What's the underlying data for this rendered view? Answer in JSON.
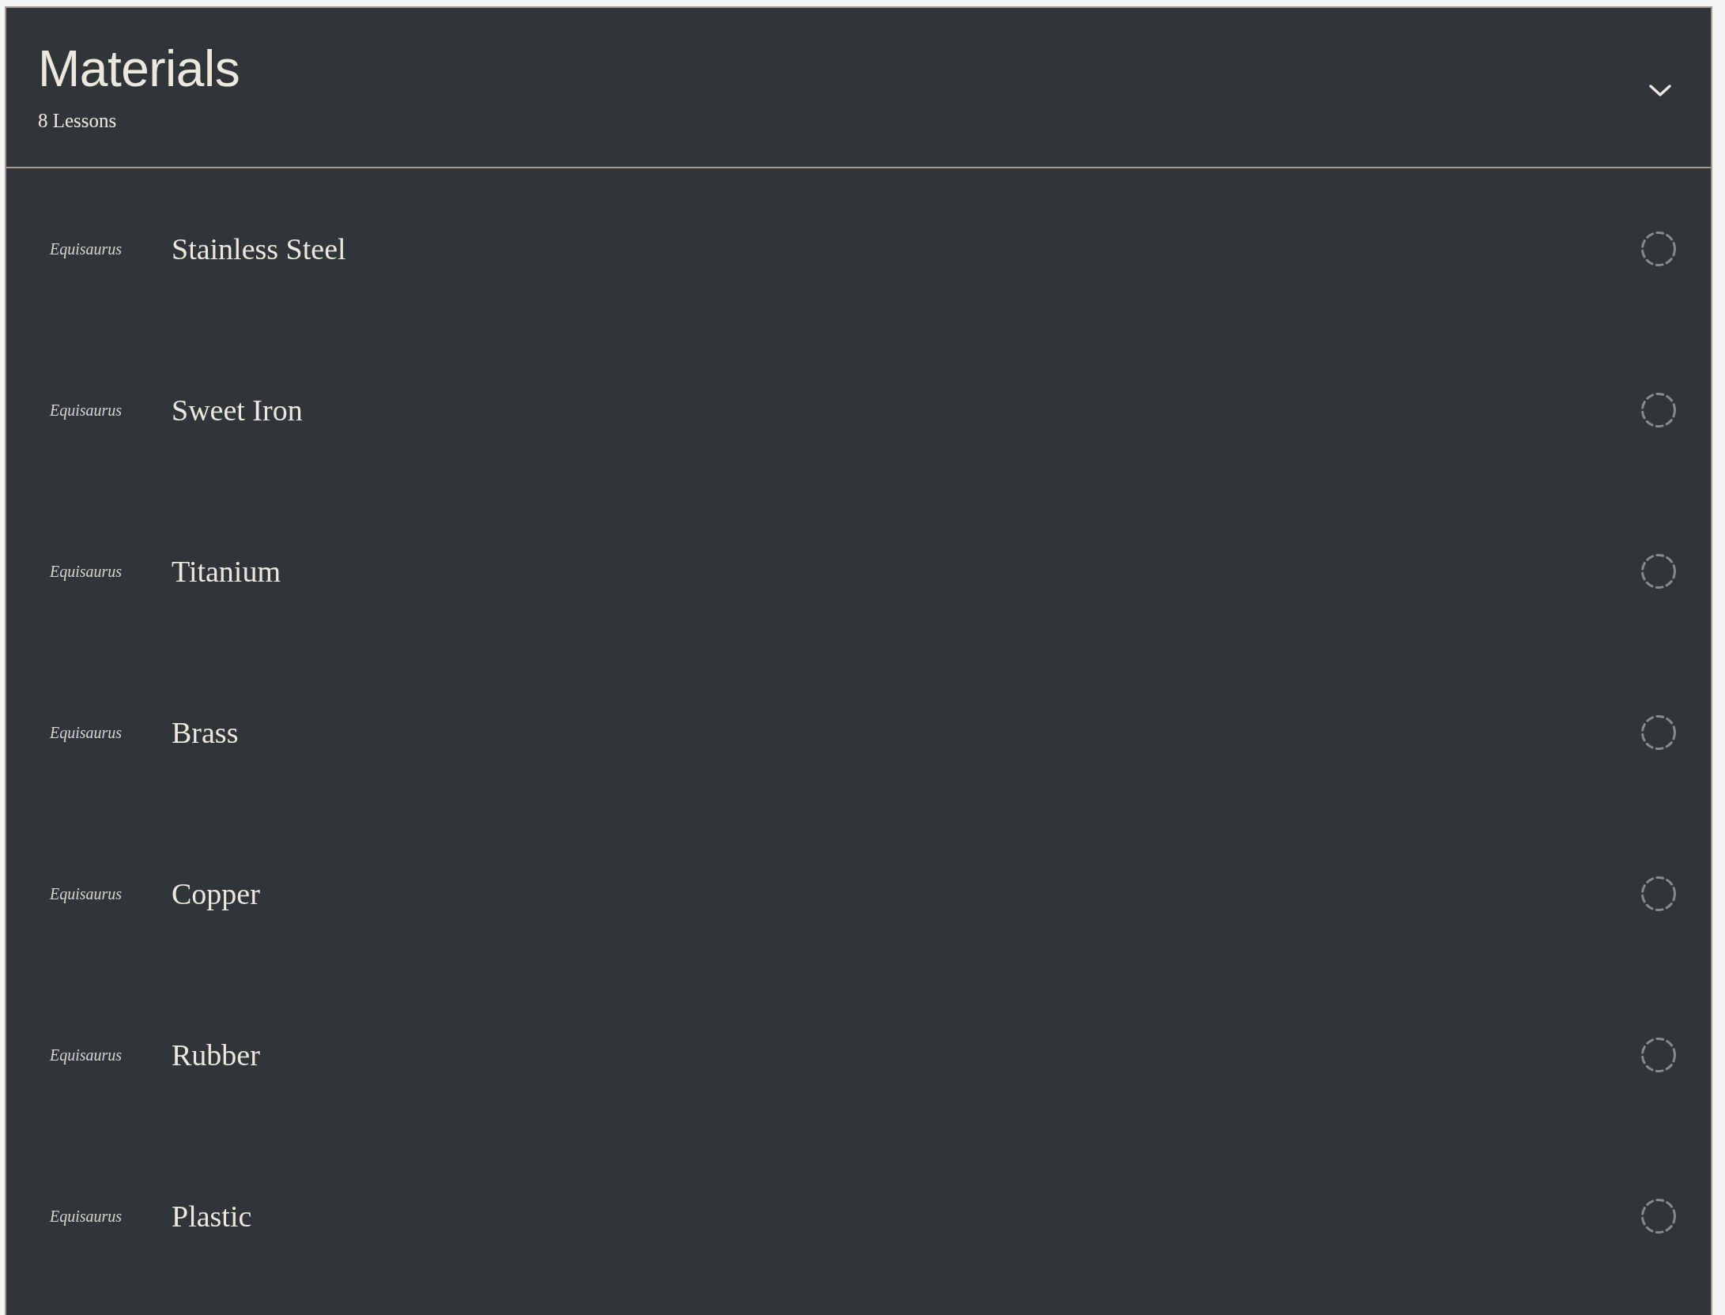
{
  "section": {
    "title": "Materials",
    "subtitle": "8 Lessons",
    "expanded": true
  },
  "lessons": [
    {
      "thumbnail_logo": "Equisaurus",
      "title": "Stainless Steel",
      "completed": false
    },
    {
      "thumbnail_logo": "Equisaurus",
      "title": "Sweet Iron",
      "completed": false
    },
    {
      "thumbnail_logo": "Equisaurus",
      "title": "Titanium",
      "completed": false
    },
    {
      "thumbnail_logo": "Equisaurus",
      "title": "Brass",
      "completed": false
    },
    {
      "thumbnail_logo": "Equisaurus",
      "title": "Copper",
      "completed": false
    },
    {
      "thumbnail_logo": "Equisaurus",
      "title": "Rubber",
      "completed": false
    },
    {
      "thumbnail_logo": "Equisaurus",
      "title": "Plastic",
      "completed": false
    }
  ]
}
